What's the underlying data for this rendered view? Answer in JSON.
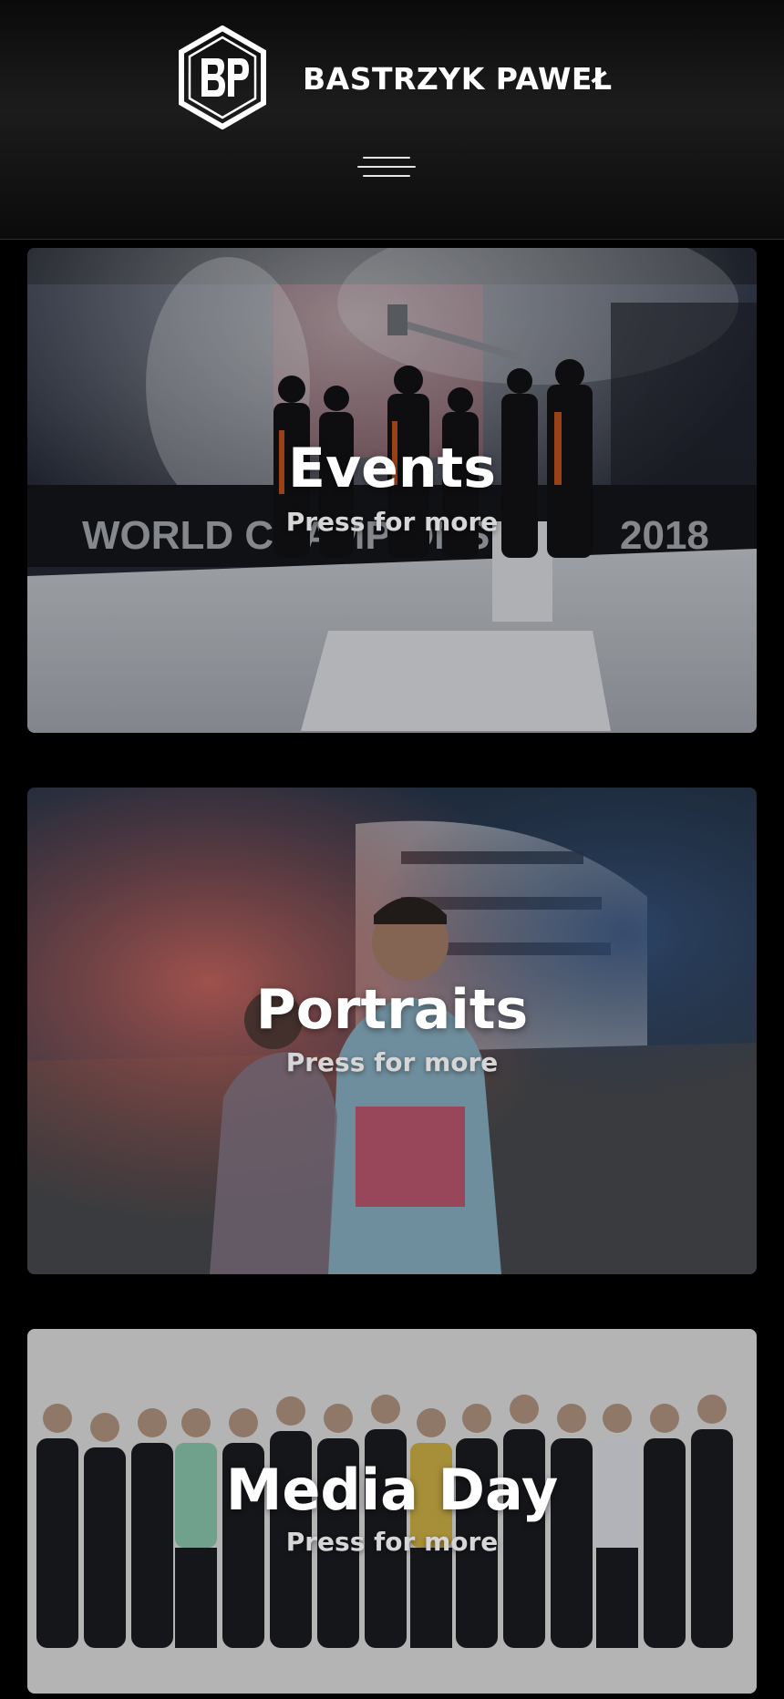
{
  "header": {
    "brand_name": "BASTRZYK PAWEŁ",
    "logo_letters": "BP",
    "logo_icon": "bp-hexagon-logo-icon",
    "menu_icon": "hamburger-menu-icon"
  },
  "categories": [
    {
      "title": "Events",
      "subtitle": "Press for more"
    },
    {
      "title": "Portraits",
      "subtitle": "Press for more"
    },
    {
      "title": "Media Day",
      "subtitle": "Press for more"
    }
  ],
  "colors": {
    "background": "#000000",
    "header_gradient_mid": "#1c1c1c",
    "title_text": "#ffffff",
    "subtitle_text": "#d6d6d6"
  }
}
